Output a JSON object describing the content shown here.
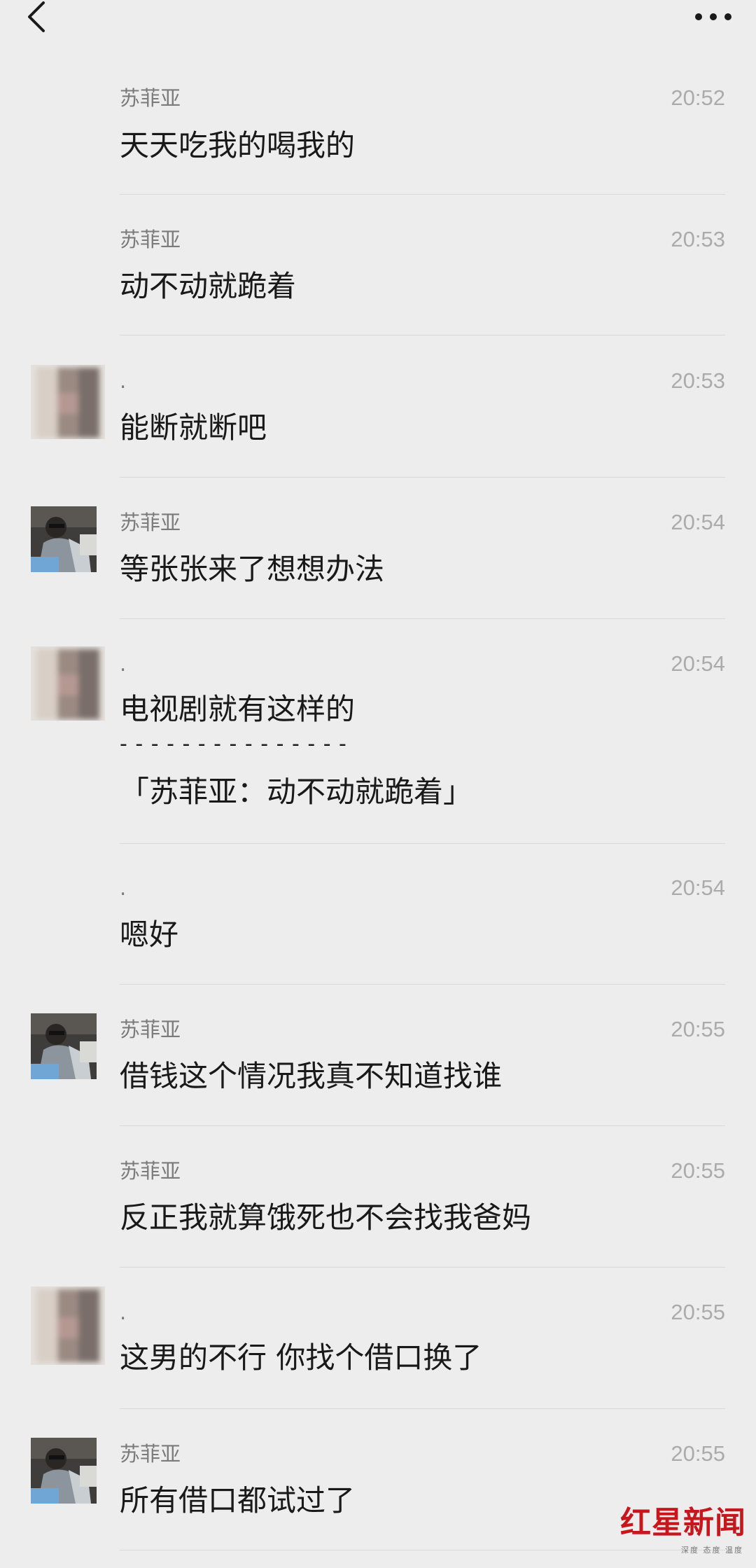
{
  "header": {
    "back_icon": "chevron-left-icon",
    "more_icon": "more-dots-icon"
  },
  "messages": [
    {
      "sender": "苏菲亚",
      "time": "20:52",
      "lines": [
        "天天吃我的喝我的"
      ],
      "avatar": "none"
    },
    {
      "sender": "苏菲亚",
      "time": "20:53",
      "lines": [
        "动不动就跪着"
      ],
      "avatar": "none"
    },
    {
      "sender": ".",
      "time": "20:53",
      "lines": [
        "能断就断吧"
      ],
      "avatar": "blurred"
    },
    {
      "sender": "苏菲亚",
      "time": "20:54",
      "lines": [
        "等张张来了想想办法"
      ],
      "avatar": "photo"
    },
    {
      "sender": ".",
      "time": "20:54",
      "lines": [
        "电视剧就有这样的",
        "- - - - - - - - - - - - - - -",
        "「苏菲亚：动不动就跪着」"
      ],
      "avatar": "blurred"
    },
    {
      "sender": ".",
      "time": "20:54",
      "lines": [
        "嗯好"
      ],
      "avatar": "none"
    },
    {
      "sender": "苏菲亚",
      "time": "20:55",
      "lines": [
        "借钱这个情况我真不知道找谁"
      ],
      "avatar": "photo"
    },
    {
      "sender": "苏菲亚",
      "time": "20:55",
      "lines": [
        "反正我就算饿死也不会找我爸妈"
      ],
      "avatar": "none"
    },
    {
      "sender": ".",
      "time": "20:55",
      "lines": [
        "这男的不行 你找个借口换了"
      ],
      "avatar": "blurred"
    },
    {
      "sender": "苏菲亚",
      "time": "20:55",
      "lines": [
        "所有借口都试过了"
      ],
      "avatar": "photo"
    }
  ],
  "watermark": {
    "name": "红星新闻",
    "tagline": "深度 态度 温度"
  }
}
